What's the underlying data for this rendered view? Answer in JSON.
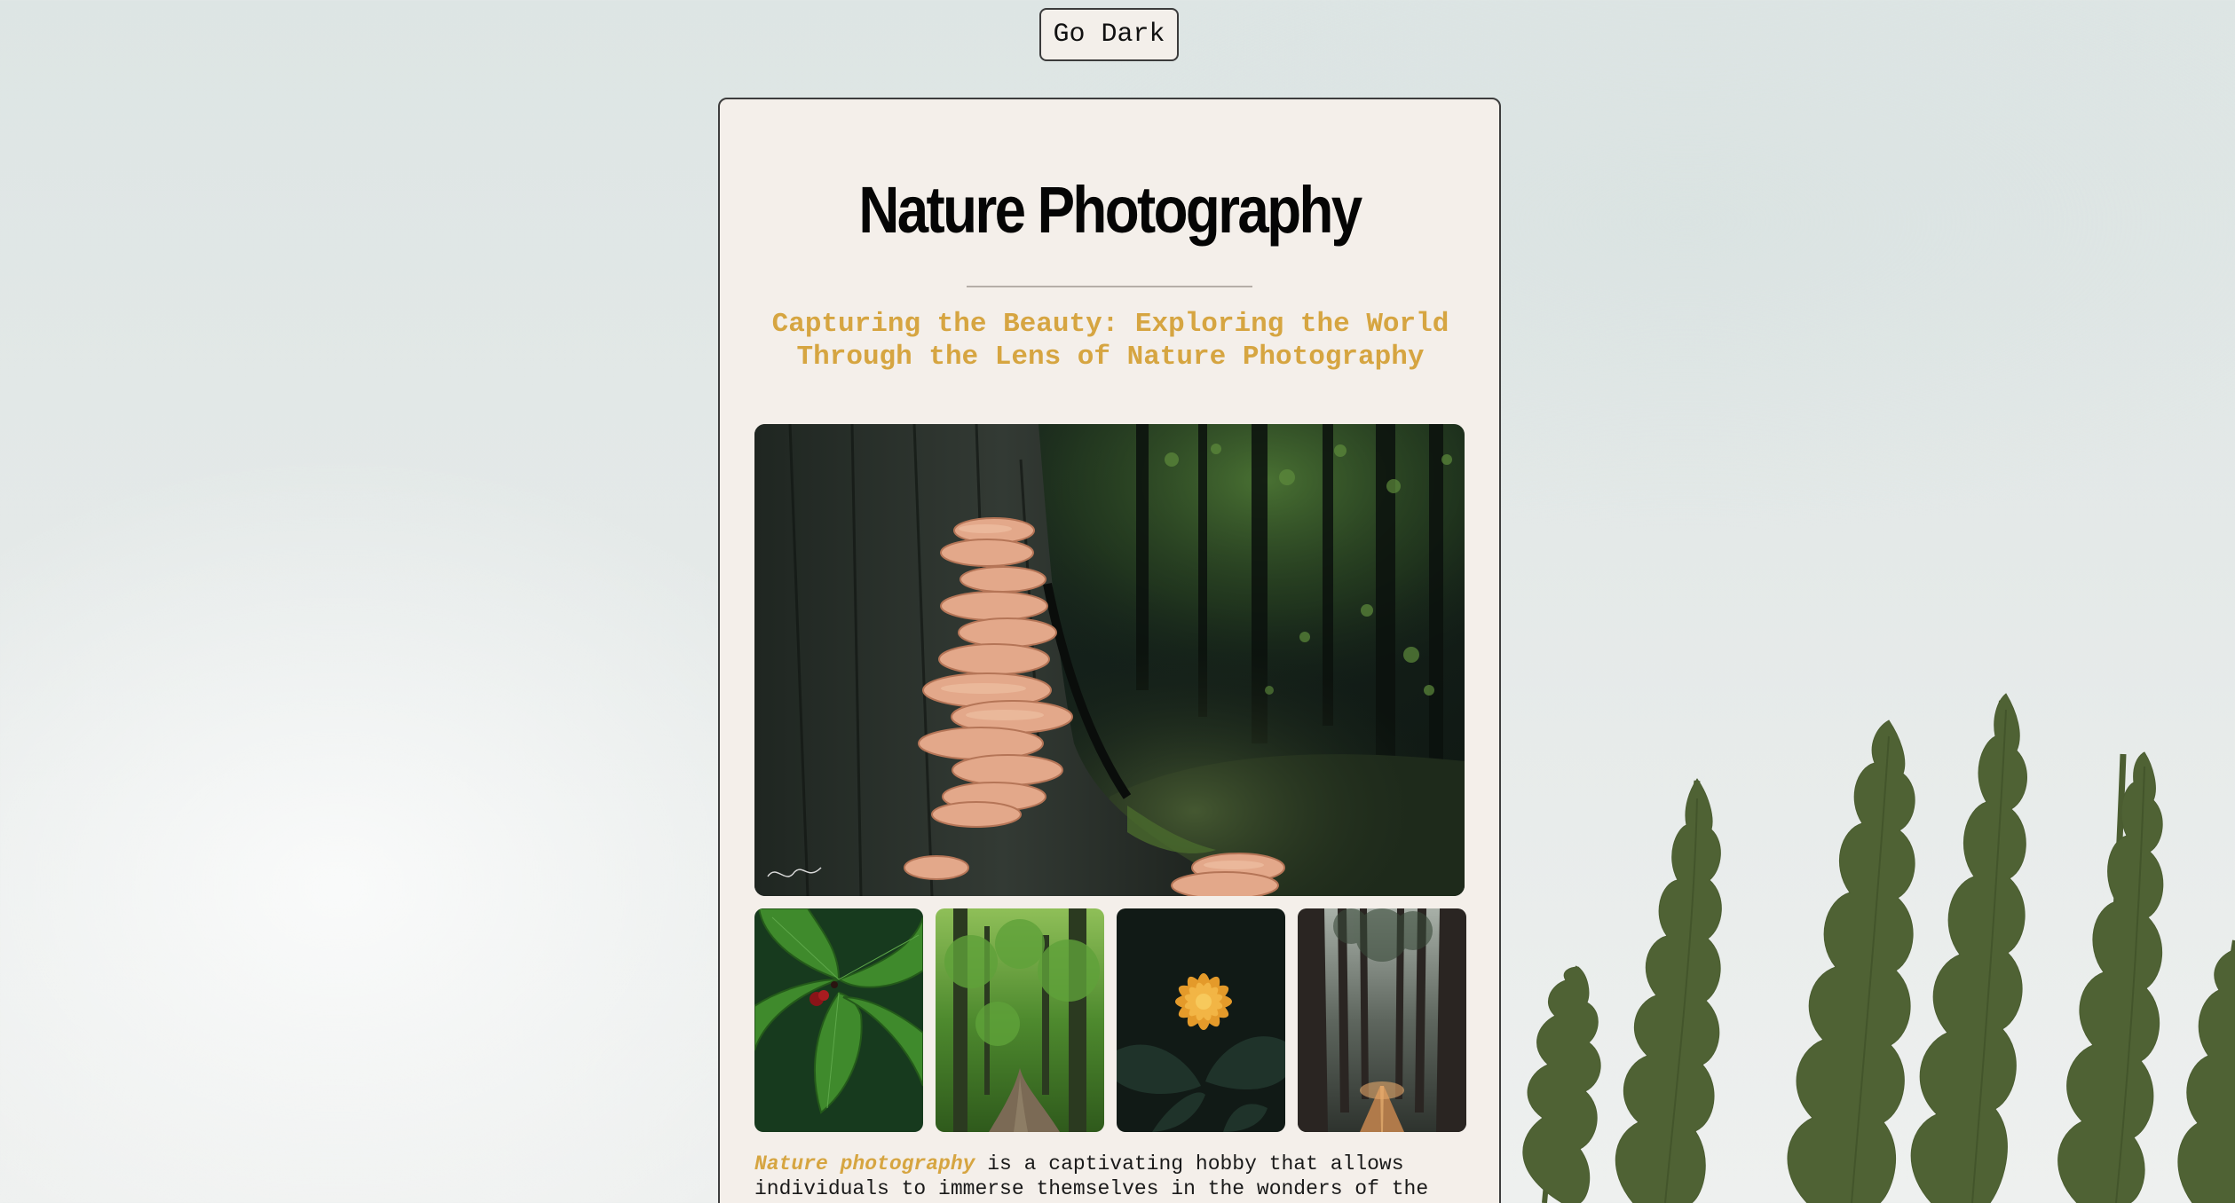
{
  "theme_toggle": {
    "label": "Go Dark"
  },
  "article": {
    "title": "Nature Photography",
    "subtitle": "Capturing the Beauty: Exploring the World Through the Lens of Nature Photography",
    "intro_highlight": "Nature photography",
    "intro_text": " is a captivating hobby that allows individuals to immerse themselves in the wonders of the"
  },
  "gallery": {
    "hero": {
      "subject": "orange bracket mushrooms on a tree trunk in a dark forest"
    },
    "thumbnails": [
      {
        "subject": "green leaves with red berries"
      },
      {
        "subject": "green forest path"
      },
      {
        "subject": "orange dahlia flower"
      },
      {
        "subject": "tall trees road"
      }
    ]
  },
  "colors": {
    "accent": "#d6a541",
    "card_background": "#f4efea",
    "page_background": "#dde5e4",
    "title_text": "#050505"
  }
}
